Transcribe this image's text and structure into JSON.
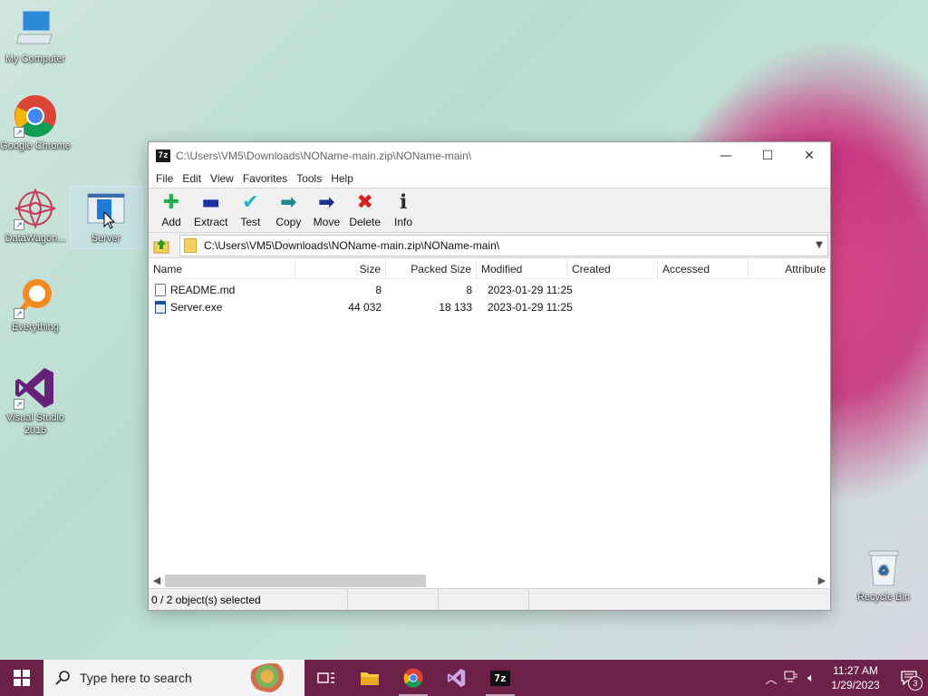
{
  "desktop": {
    "icons": [
      {
        "label": "My Computer"
      },
      {
        "label": "Google Chrome"
      },
      {
        "label": "DataWagon..."
      },
      {
        "label": "Server"
      },
      {
        "label": "Everything"
      },
      {
        "label": "Visual Studio 2015"
      },
      {
        "label": "Recycle Bin"
      }
    ]
  },
  "window": {
    "app_icon_text": "7z",
    "title": "C:\\Users\\VM5\\Downloads\\NOName-main.zip\\NOName-main\\",
    "controls": {
      "minimize": "—",
      "maximize": "☐",
      "close": "✕"
    },
    "menu": [
      "File",
      "Edit",
      "View",
      "Favorites",
      "Tools",
      "Help"
    ],
    "toolbar": [
      {
        "label": "Add",
        "icon": "add-icon",
        "glyph": "✚",
        "color": "#22b14c"
      },
      {
        "label": "Extract",
        "icon": "extract-icon",
        "glyph": "▬",
        "color": "#1f2fa8"
      },
      {
        "label": "Test",
        "icon": "test-icon",
        "glyph": "✔",
        "color": "#1fb4c8"
      },
      {
        "label": "Copy",
        "icon": "copy-icon",
        "glyph": "➡",
        "color": "#1a8a8a"
      },
      {
        "label": "Move",
        "icon": "move-icon",
        "glyph": "➡",
        "color": "#1f2f8a"
      },
      {
        "label": "Delete",
        "icon": "delete-icon",
        "glyph": "✖",
        "color": "#d81e1e"
      },
      {
        "label": "Info",
        "icon": "info-icon",
        "glyph": "ℹ",
        "color": "#2a2a2a"
      }
    ],
    "address": {
      "path": "C:\\Users\\VM5\\Downloads\\NOName-main.zip\\NOName-main\\"
    },
    "columns": [
      "Name",
      "Size",
      "Packed Size",
      "Modified",
      "Created",
      "Accessed",
      "Attribute"
    ],
    "files": [
      {
        "name": "README.md",
        "size": "8",
        "packed": "8",
        "modified": "2023-01-29 11:25",
        "created": "",
        "accessed": "",
        "attr": "",
        "type": "file"
      },
      {
        "name": "Server.exe",
        "size": "44 032",
        "packed": "18 133",
        "modified": "2023-01-29 11:25",
        "created": "",
        "accessed": "",
        "attr": "",
        "type": "exe"
      }
    ],
    "status": "0 / 2 object(s) selected"
  },
  "taskbar": {
    "search_placeholder": "Type here to search",
    "time": "11:27 AM",
    "date": "1/29/2023",
    "notification_count": "3",
    "accent_color": "#6e2148"
  }
}
